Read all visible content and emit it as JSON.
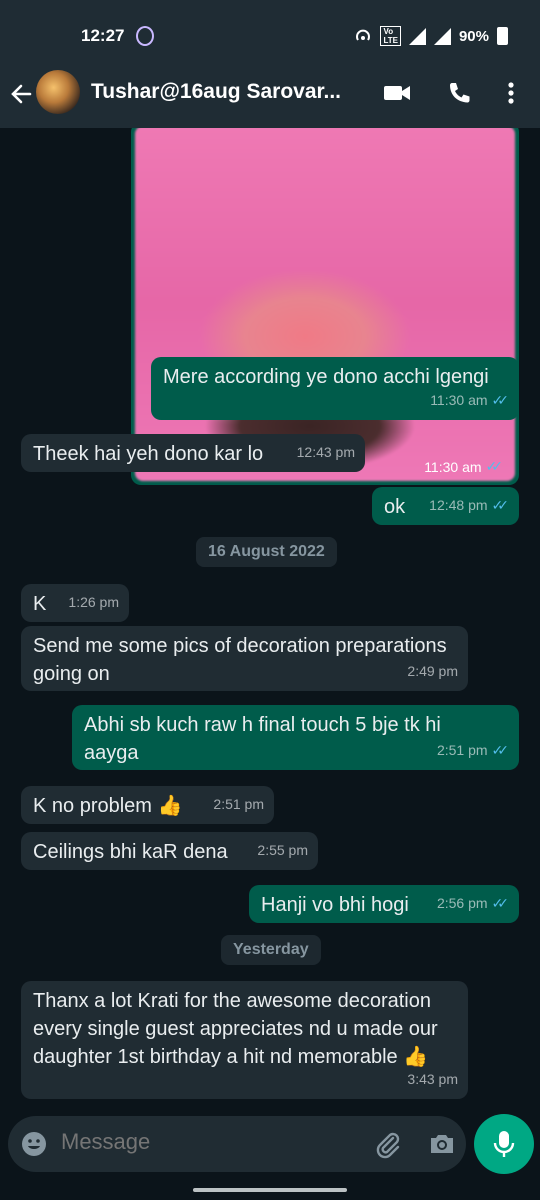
{
  "status": {
    "time": "12:27",
    "battery": "90%",
    "network": "4G"
  },
  "header": {
    "contact_name": "Tushar@16aug Sarovar..."
  },
  "messages": [
    {
      "type": "media",
      "time": "11:30 am"
    },
    {
      "type": "out",
      "text": "Mere according ye dono acchi lgengi",
      "time": "11:30 am"
    },
    {
      "type": "in",
      "text": "Theek hai yeh dono kar lo",
      "time": "12:43 pm"
    },
    {
      "type": "out",
      "text": "ok",
      "time": "12:48 pm"
    },
    {
      "type": "date",
      "text": "16 August 2022"
    },
    {
      "type": "in",
      "text": "K",
      "time": "1:26 pm"
    },
    {
      "type": "in",
      "text": "Send me some pics of decoration preparations going on",
      "time": "2:49 pm"
    },
    {
      "type": "out",
      "text": "Abhi sb kuch raw h final touch 5 bje tk hi aayga",
      "time": "2:51 pm"
    },
    {
      "type": "in",
      "text": "K no problem 👍",
      "time": "2:51 pm"
    },
    {
      "type": "in",
      "text": "Ceilings bhi kaR dena",
      "time": "2:55 pm"
    },
    {
      "type": "out",
      "text": "Hanji vo bhi hogi",
      "time": "2:56 pm"
    },
    {
      "type": "date",
      "text": "Yesterday"
    },
    {
      "type": "in",
      "text": "Thanx a lot Krati for the awesome decoration every single guest appreciates nd u made our daughter 1st birthday a hit nd memorable 👍",
      "time": "3:43 pm"
    }
  ],
  "input": {
    "placeholder": "Message"
  },
  "colors": {
    "outgoing": "#005c4b",
    "incoming": "#202c33",
    "accent": "#00a884"
  }
}
